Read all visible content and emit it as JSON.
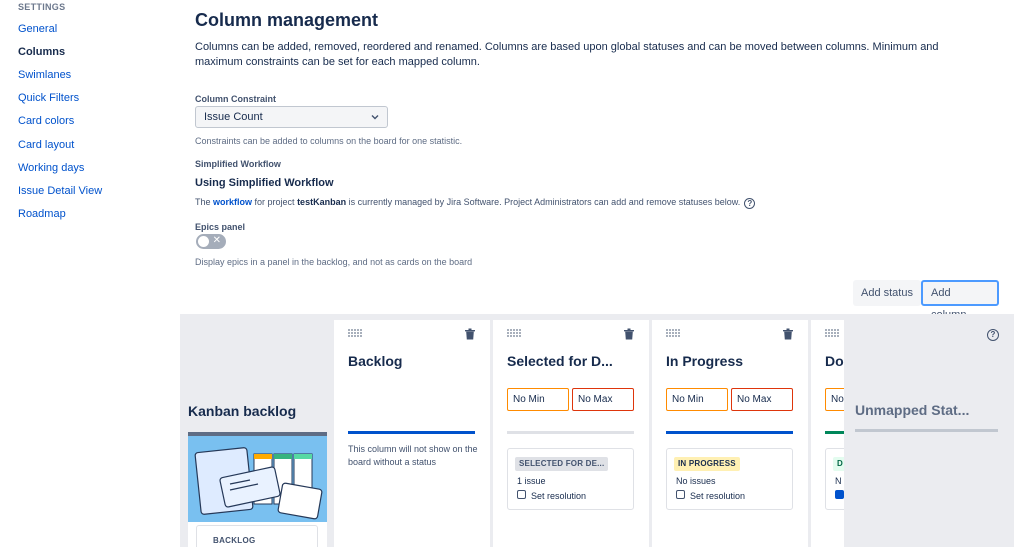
{
  "sidebar": {
    "header": "SETTINGS",
    "items": [
      {
        "label": "General"
      },
      {
        "label": "Columns"
      },
      {
        "label": "Swimlanes"
      },
      {
        "label": "Quick Filters"
      },
      {
        "label": "Card colors"
      },
      {
        "label": "Card layout"
      },
      {
        "label": "Working days"
      },
      {
        "label": "Issue Detail View"
      },
      {
        "label": "Roadmap"
      }
    ],
    "active": "Columns"
  },
  "page": {
    "title": "Column management",
    "description": "Columns can be added, removed, reordered and renamed. Columns are based upon global statuses and can be moved between columns. Minimum and maximum constraints can be set for each mapped column."
  },
  "constraint": {
    "label": "Column Constraint",
    "value": "Issue Count",
    "help": "Constraints can be added to columns on the board for one statistic."
  },
  "workflow": {
    "label": "Simplified Workflow",
    "title": "Using Simplified Workflow",
    "text_pre": "The ",
    "link": "workflow",
    "text_mid": " for project ",
    "project": "testKanban",
    "text_post": " is currently managed by Jira Software. Project Administrators can add and remove statuses below."
  },
  "epics": {
    "label": "Epics panel",
    "toggle_state": "off",
    "toggle_symbol": "✕",
    "help": "Display epics in a panel in the backlog, and not as cards on the board"
  },
  "buttons": {
    "add_status": "Add status",
    "add_column": "Add column"
  },
  "board": {
    "kanban_backlog_title": "Kanban backlog",
    "backlog_lozenge": "BACKLOG",
    "columns": [
      {
        "name": "Backlog",
        "note": "This column will not show on the board without a status",
        "bar_color": "#0052cc"
      },
      {
        "name": "Selected for D...",
        "min": "No Min",
        "max": "No Max",
        "bar_color": "#dfe1e6",
        "status": "SELECTED FOR DE...",
        "status_bg": "#dfe1e6",
        "status_fg": "#42526e",
        "count": "1 issue",
        "set_resolution": "Set resolution"
      },
      {
        "name": "In Progress",
        "min": "No Min",
        "max": "No Max",
        "bar_color": "#0052cc",
        "status": "IN PROGRESS",
        "status_bg": "#fff0b3",
        "status_fg": "#172b4d",
        "count": "No issues",
        "set_resolution": "Set resolution"
      },
      {
        "name": "Do",
        "min": "No",
        "bar_color": "#00875a",
        "status": "D",
        "status_bg": "#e3fcef",
        "status_fg": "#006644",
        "count": "N"
      }
    ],
    "unmapped": {
      "name": "Unmapped Stat...",
      "help": "?"
    }
  }
}
